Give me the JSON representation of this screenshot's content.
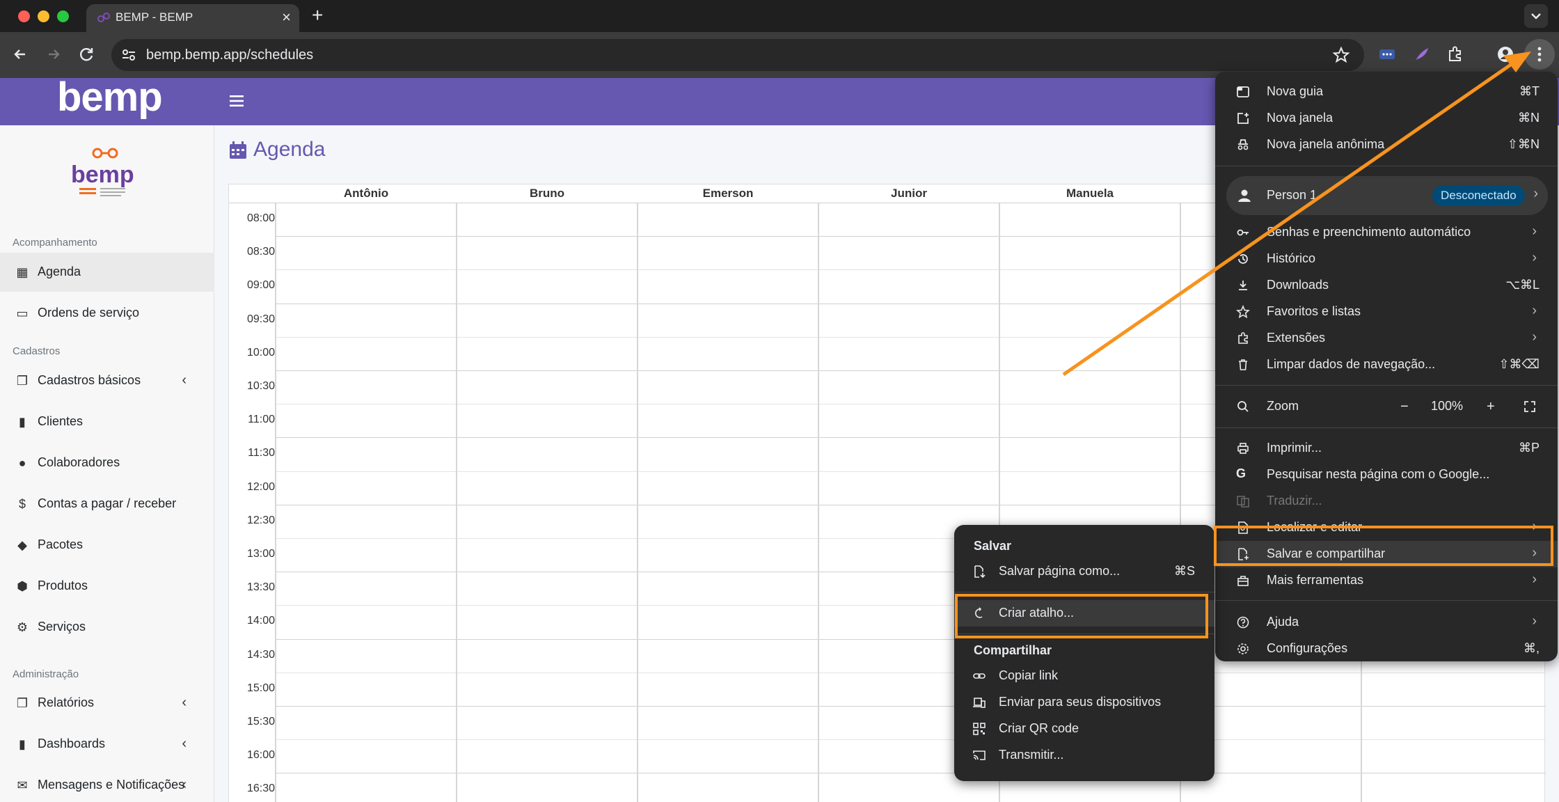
{
  "colors": {
    "brand": "#6658b0",
    "highlight": "#f7931e",
    "menu_bg": "#282828"
  },
  "browser": {
    "tab_title": "BEMP - BEMP",
    "url": "bemp.bemp.app/schedules"
  },
  "app": {
    "logo": "bemp",
    "page_title": "Agenda"
  },
  "sidebar": {
    "sections": [
      "Acompanhamento",
      "Cadastros",
      "Administração"
    ],
    "items": [
      {
        "label": "Agenda",
        "icon": "calendar-icon"
      },
      {
        "label": "Ordens de serviço",
        "icon": "ticket-icon"
      },
      {
        "label": "Cadastros básicos",
        "icon": "copy-icon"
      },
      {
        "label": "Clientes",
        "icon": "bookmark-icon"
      },
      {
        "label": "Colaboradores",
        "icon": "user-icon"
      },
      {
        "label": "Contas a pagar / receber",
        "icon": "invoice-icon"
      },
      {
        "label": "Pacotes",
        "icon": "dropbox-icon"
      },
      {
        "label": "Produtos",
        "icon": "cube-icon"
      },
      {
        "label": "Serviços",
        "icon": "user-gear-icon"
      },
      {
        "label": "Relatórios",
        "icon": "copy-icon"
      },
      {
        "label": "Dashboards",
        "icon": "bookmark-icon"
      },
      {
        "label": "Mensagens e Notificações",
        "icon": "envelope-icon"
      }
    ]
  },
  "schedule": {
    "columns": [
      "Antônio",
      "Bruno",
      "Emerson",
      "Junior",
      "Manuela"
    ],
    "times": [
      "08:00",
      "08:30",
      "09:00",
      "09:30",
      "10:00",
      "10:30",
      "11:00",
      "11:30",
      "12:00",
      "12:30",
      "13:00",
      "13:30",
      "14:00",
      "14:30",
      "15:00",
      "15:30",
      "16:00",
      "16:30"
    ]
  },
  "chrome_menu": {
    "nova_guia": {
      "label": "Nova guia",
      "shortcut": "⌘T"
    },
    "nova_janela": {
      "label": "Nova janela",
      "shortcut": "⌘N"
    },
    "anonima": {
      "label": "Nova janela anônima",
      "shortcut": "⇧⌘N"
    },
    "profile": {
      "name": "Person 1",
      "status": "Desconectado"
    },
    "senhas": {
      "label": "Senhas e preenchimento automático"
    },
    "historico": {
      "label": "Histórico"
    },
    "downloads": {
      "label": "Downloads",
      "shortcut": "⌥⌘L"
    },
    "favoritos": {
      "label": "Favoritos e listas"
    },
    "extensoes": {
      "label": "Extensões"
    },
    "limpar": {
      "label": "Limpar dados de navegação...",
      "shortcut": "⇧⌘⌫"
    },
    "zoom": {
      "label": "Zoom",
      "minus": "−",
      "value": "100%",
      "plus": "+"
    },
    "imprimir": {
      "label": "Imprimir...",
      "shortcut": "⌘P"
    },
    "pesquisar": {
      "label": "Pesquisar nesta página com o Google..."
    },
    "traduzir": {
      "label": "Traduzir..."
    },
    "localizar": {
      "label": "Localizar e editar"
    },
    "salvar": {
      "label": "Salvar e compartilhar"
    },
    "mais": {
      "label": "Mais ferramentas"
    },
    "ajuda": {
      "label": "Ajuda"
    },
    "config": {
      "label": "Configurações",
      "shortcut": "⌘,"
    }
  },
  "submenu": {
    "salvar_header": "Salvar",
    "salvar_pagina": {
      "label": "Salvar página como...",
      "shortcut": "⌘S"
    },
    "criar_atalho": {
      "label": "Criar atalho..."
    },
    "compartilhar_header": "Compartilhar",
    "copiar_link": {
      "label": "Copiar link"
    },
    "enviar": {
      "label": "Enviar para seus dispositivos"
    },
    "qr": {
      "label": "Criar QR code"
    },
    "transmitir": {
      "label": "Transmitir..."
    }
  }
}
